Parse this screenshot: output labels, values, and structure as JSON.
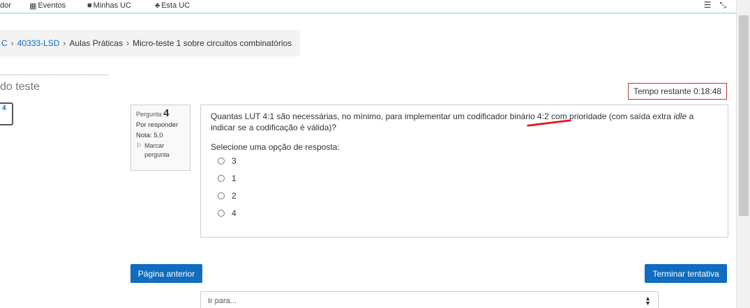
{
  "navbar": {
    "items": [
      {
        "label": "dor",
        "icon": ""
      },
      {
        "label": "Eventos",
        "icon": "calendar-icon"
      },
      {
        "label": "Minhas UC",
        "icon": "briefcase-icon"
      },
      {
        "label": "Esta UC",
        "icon": "sitemap-icon"
      }
    ],
    "right_icons": [
      "indent-icon",
      "collapse-icon"
    ]
  },
  "breadcrumb": {
    "partial": "C",
    "items": [
      "40333-LSD",
      "Aulas Práticas",
      "Micro-teste 1 sobre circuitos combinatórios"
    ]
  },
  "quiz_nav": {
    "title_partial": "do teste",
    "question_button": "4"
  },
  "timer": {
    "text": "Tempo restante 0:18:48"
  },
  "question_info": {
    "label": "Pergunta",
    "number": "4",
    "status": "Por responder",
    "grade": "Nota: 5,0",
    "flag": "Marcar pergunta"
  },
  "question": {
    "text_before": "Quantas LUT 4:1 são necessárias, no mínimo, para implementar um codificador binário 4:2 com prioridade (com saída extra ",
    "text_emphasis": "idle",
    "text_after": " a indicar se a codificação é válida)?",
    "prompt": "Selecione uma opção de resposta:",
    "options": [
      "3",
      "1",
      "2",
      "4"
    ]
  },
  "buttons": {
    "previous": "Página anterior",
    "finish": "Terminar tentativa"
  },
  "jump_select": {
    "selected": "Ir para..."
  }
}
